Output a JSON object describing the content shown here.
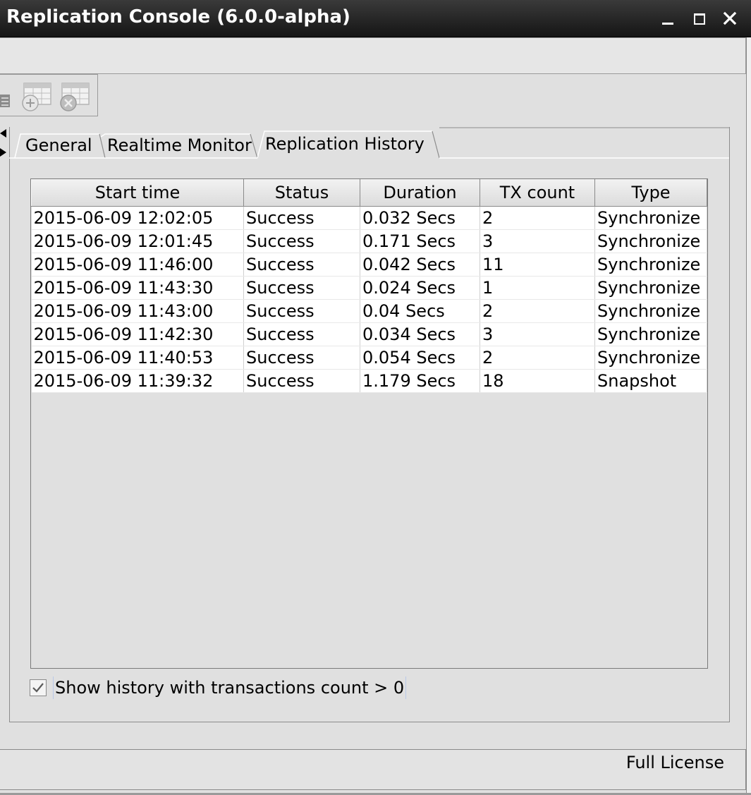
{
  "window": {
    "title": "Replication Console (6.0.0-alpha)",
    "minimize_glyph": "_",
    "maximize_glyph": "□",
    "close_glyph": "✕"
  },
  "toolbar": {
    "icons": [
      "partial-tool-icon",
      "add-table-icon",
      "remove-table-icon"
    ]
  },
  "tabs": [
    {
      "label": "General",
      "selected": false
    },
    {
      "label": "Realtime Monitor",
      "selected": false
    },
    {
      "label": "Replication History",
      "selected": true
    }
  ],
  "history_table": {
    "columns": [
      "Start time",
      "Status",
      "Duration",
      "TX count",
      "Type"
    ],
    "rows": [
      [
        "2015-06-09 12:02:05",
        "Success",
        "0.032 Secs",
        "2",
        "Synchronize"
      ],
      [
        "2015-06-09 12:01:45",
        "Success",
        "0.171 Secs",
        "3",
        "Synchronize"
      ],
      [
        "2015-06-09 11:46:00",
        "Success",
        "0.042 Secs",
        "11",
        "Synchronize"
      ],
      [
        "2015-06-09 11:43:30",
        "Success",
        "0.024 Secs",
        "1",
        "Synchronize"
      ],
      [
        "2015-06-09 11:43:00",
        "Success",
        "0.04 Secs",
        "2",
        "Synchronize"
      ],
      [
        "2015-06-09 11:42:30",
        "Success",
        "0.034 Secs",
        "3",
        "Synchronize"
      ],
      [
        "2015-06-09 11:40:53",
        "Success",
        "0.054 Secs",
        "2",
        "Synchronize"
      ],
      [
        "2015-06-09 11:39:32",
        "Success",
        "1.179 Secs",
        "18",
        "Snapshot"
      ]
    ]
  },
  "filter": {
    "label": "Show history with transactions count > 0",
    "checked": true
  },
  "status": {
    "license": "Full License"
  }
}
